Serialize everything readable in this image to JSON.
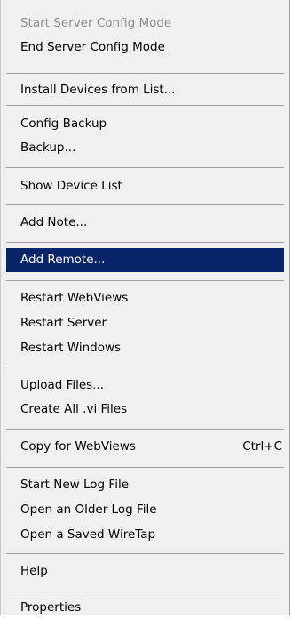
{
  "menu": {
    "items": [
      {
        "label": "Start Server Config Mode",
        "enabled": false
      },
      {
        "label": "End Server Config Mode"
      },
      {
        "label": "Install Devices from List..."
      },
      {
        "label": "Config Backup"
      },
      {
        "label": "Backup..."
      },
      {
        "label": "Show Device List"
      },
      {
        "label": "Add Note..."
      },
      {
        "label": "Add Remote...",
        "selected": true
      },
      {
        "label": "Restart WebViews"
      },
      {
        "label": "Restart Server"
      },
      {
        "label": "Restart Windows"
      },
      {
        "label": "Upload Files..."
      },
      {
        "label": "Create All .vi Files"
      },
      {
        "label": "Copy for WebViews",
        "shortcut": "Ctrl+C"
      },
      {
        "label": "Start New Log File"
      },
      {
        "label": "Open an Older Log File"
      },
      {
        "label": "Open a Saved WireTap"
      },
      {
        "label": "Help"
      },
      {
        "label": "Properties"
      }
    ]
  },
  "colors": {
    "menu_background": "#f0f0f0",
    "selection_background": "#0a246a",
    "disabled_text": "#8d8d8d",
    "separator": "#a0a0a0"
  }
}
